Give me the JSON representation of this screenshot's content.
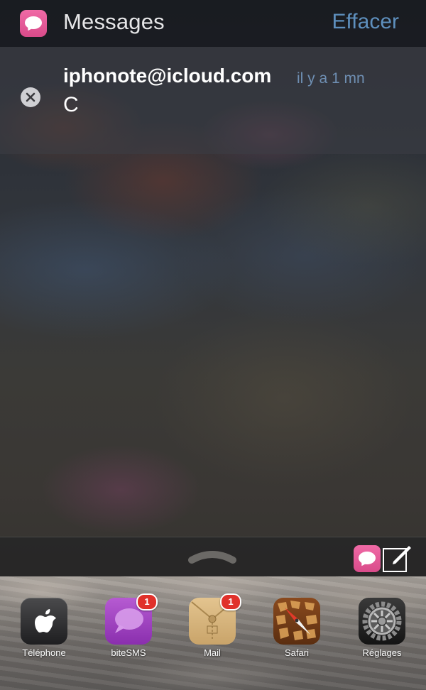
{
  "notification_center": {
    "app_name": "Messages",
    "clear_label": "Effacer",
    "app_icon": "messages-icon",
    "accent_color": "#5e8fbd"
  },
  "notification": {
    "sender": "iphonote@icloud.com",
    "time": "il y a 1 mn",
    "message": "C",
    "dismiss_icon": "close-icon"
  },
  "bottom_bar": {
    "grabber_icon": "chevron-up-icon",
    "quick_reply_icon": "messages-icon",
    "compose_icon": "compose-icon"
  },
  "dock": {
    "items": [
      {
        "label": "Téléphone",
        "icon": "apple-logo-icon",
        "badge": null
      },
      {
        "label": "biteSMS",
        "icon": "chat-bubble-icon",
        "badge": "1"
      },
      {
        "label": "Mail",
        "icon": "envelope-icon",
        "badge": "1"
      },
      {
        "label": "Safari",
        "icon": "compass-icon",
        "badge": null
      },
      {
        "label": "Réglages",
        "icon": "gear-icon",
        "badge": null
      }
    ]
  }
}
